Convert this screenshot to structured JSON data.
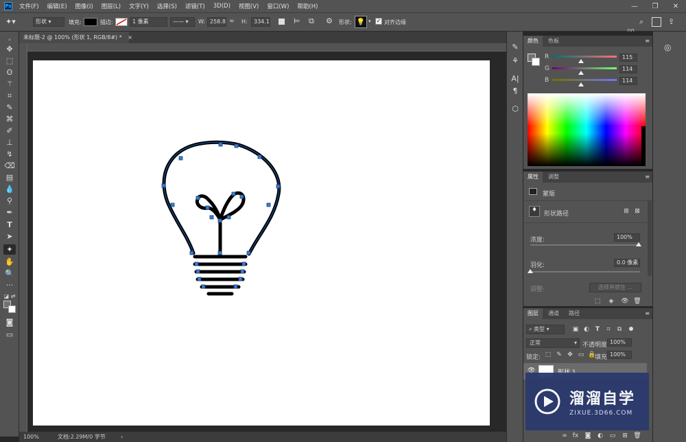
{
  "app": {
    "logo": "Ps"
  },
  "menu": [
    "文件(F)",
    "编辑(E)",
    "图像(I)",
    "图层(L)",
    "文字(Y)",
    "选择(S)",
    "滤镜(T)",
    "3D(D)",
    "视图(V)",
    "窗口(W)",
    "帮助(H)"
  ],
  "options": {
    "tool_mode": "形状",
    "fill_label": "填充:",
    "stroke_label": "描边:",
    "stroke_width": "1 像素",
    "w_label": "W:",
    "w_value": "258.81",
    "h_label": "H:",
    "h_value": "334.13",
    "shape_label": "形状:",
    "align_label": "对齐边缘",
    "align_checked": true
  },
  "document": {
    "tab_title": "未标题-2 @ 100% (形状 1, RGB/8#) *",
    "zoom": "100%",
    "doc_info": "文档:2.29M/0 字节"
  },
  "color_panel": {
    "tabs": [
      "颜色",
      "色板"
    ],
    "channels": [
      {
        "name": "R",
        "value": "115"
      },
      {
        "name": "G",
        "value": "114"
      },
      {
        "name": "B",
        "value": "114"
      }
    ]
  },
  "properties_panel": {
    "tabs": [
      "属性",
      "调整"
    ],
    "mask_label": "蒙版",
    "vector_mask_label": "形状路径",
    "density_label": "浓度:",
    "density_value": "100%",
    "feather_label": "羽化:",
    "feather_value": "0.0 像素",
    "refine_label": "调整:",
    "select_mask_label": "选择并遮住 ..."
  },
  "layers_panel": {
    "tabs": [
      "图层",
      "通道",
      "路径"
    ],
    "filter_kind": "类型",
    "blend_mode": "正常",
    "opacity_label": "不透明度:",
    "opacity_value": "100%",
    "lock_label": "锁定:",
    "fill_label": "填充:",
    "fill_value": "100%",
    "layers": [
      {
        "name": "形状 1"
      }
    ]
  },
  "watermark": {
    "brand": "溜溜自学",
    "url": "ZIXUE.3D66.COM"
  }
}
